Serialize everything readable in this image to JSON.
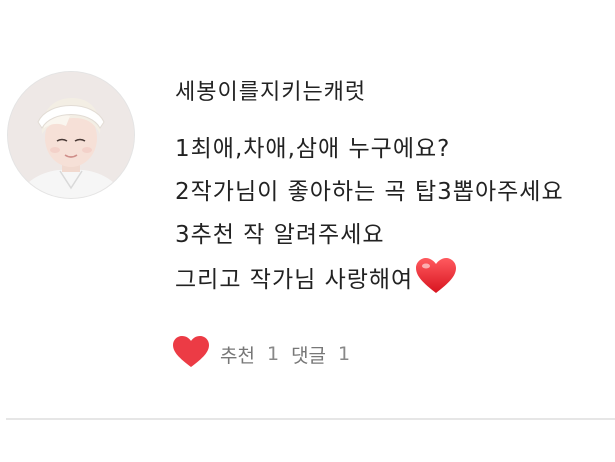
{
  "comment": {
    "author": "세봉이를지키는캐럿",
    "lines": [
      "1최애,차애,삼애 누구에요?",
      "2작가님이 좋아하는 곡 탑3뽑아주세요",
      "3추천 작 알려주세요",
      "그리고 작가님 사랑해여"
    ],
    "inline_emoji": "heart-icon"
  },
  "actions": {
    "recommend_label": "추천",
    "recommend_count": "1",
    "reply_label": "댓글",
    "reply_count": "1",
    "like_icon": "heart-icon",
    "accent_color": "#ec3b45"
  }
}
